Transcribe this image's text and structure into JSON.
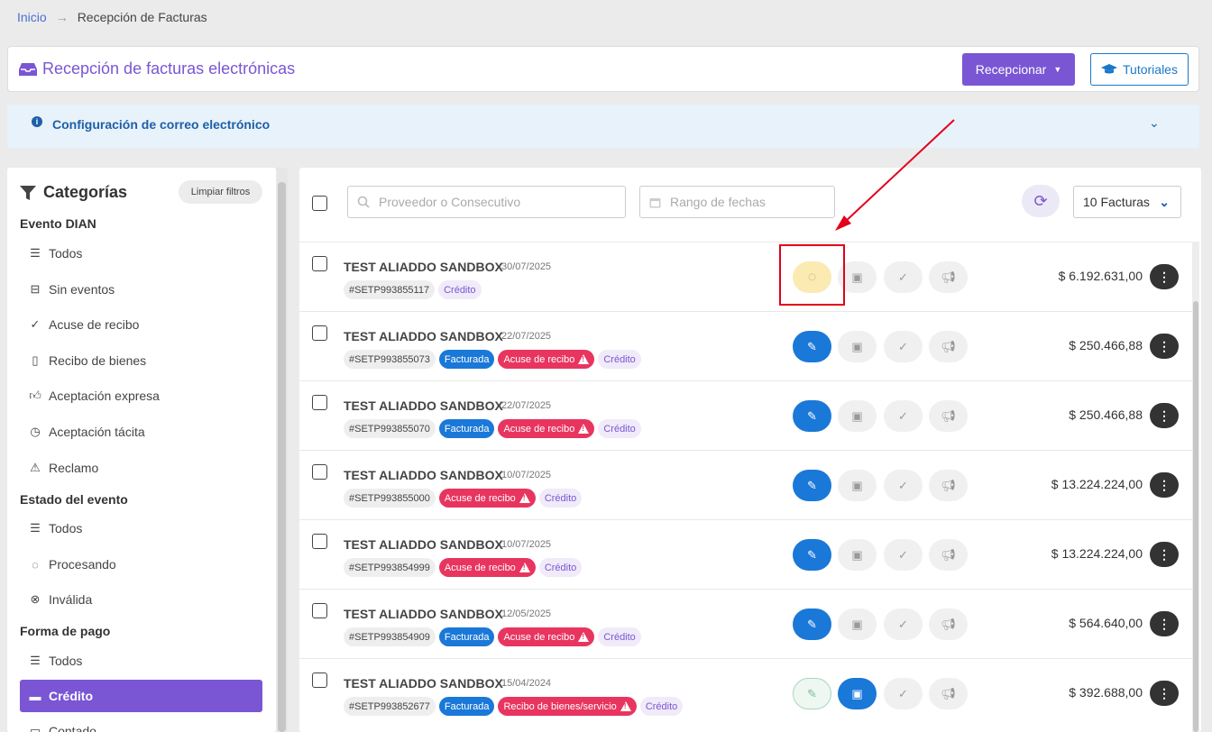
{
  "breadcrumb": {
    "home": "Inicio",
    "separator": "→",
    "current": "Recepción de Facturas"
  },
  "header": {
    "title": "Recepción de facturas electrónicas",
    "recepcionar_label": "Recepcionar",
    "tutoriales_label": "Tutoriales"
  },
  "email_config": {
    "label": "Configuración de correo electrónico"
  },
  "sidebar": {
    "title": "Categorías",
    "clear_label": "Limpiar filtros",
    "groups": [
      {
        "title": "Evento DIAN",
        "items": [
          "Todos",
          "Sin eventos",
          "Acuse de recibo",
          "Recibo de bienes",
          "Aceptación expresa",
          "Aceptación tácita",
          "Reclamo"
        ]
      },
      {
        "title": "Estado del evento",
        "items": [
          "Todos",
          "Procesando",
          "Inválida"
        ]
      },
      {
        "title": "Forma de pago",
        "items": [
          "Todos",
          "Crédito",
          "Contado"
        ]
      }
    ]
  },
  "toolbar": {
    "search_placeholder": "Proveedor o Consecutivo",
    "date_placeholder": "Rango de fechas",
    "count_label": "10 Facturas"
  },
  "invoices": [
    {
      "vendor": "TEST ALIADDO SANDBOX",
      "date": "30/07/2025",
      "number": "#SETP993855117",
      "tags": [
        {
          "text": "Crédito",
          "type": "cred"
        }
      ],
      "amount": "$ 6.192.631,00"
    },
    {
      "vendor": "TEST ALIADDO SANDBOX",
      "date": "22/07/2025",
      "number": "#SETP993855073",
      "tags": [
        {
          "text": "Facturada",
          "type": "fact"
        },
        {
          "text": "Acuse de recibo",
          "type": "acuse"
        },
        {
          "text": "Crédito",
          "type": "cred"
        }
      ],
      "amount": "$ 250.466,88"
    },
    {
      "vendor": "TEST ALIADDO SANDBOX",
      "date": "22/07/2025",
      "number": "#SETP993855070",
      "tags": [
        {
          "text": "Facturada",
          "type": "fact"
        },
        {
          "text": "Acuse de recibo",
          "type": "acuse"
        },
        {
          "text": "Crédito",
          "type": "cred"
        }
      ],
      "amount": "$ 250.466,88"
    },
    {
      "vendor": "TEST ALIADDO SANDBOX",
      "date": "10/07/2025",
      "number": "#SETP993855000",
      "tags": [
        {
          "text": "Acuse de recibo",
          "type": "acuse"
        },
        {
          "text": "Crédito",
          "type": "cred"
        }
      ],
      "amount": "$ 13.224.224,00"
    },
    {
      "vendor": "TEST ALIADDO SANDBOX",
      "date": "10/07/2025",
      "number": "#SETP993854999",
      "tags": [
        {
          "text": "Acuse de recibo",
          "type": "acuse"
        },
        {
          "text": "Crédito",
          "type": "cred"
        }
      ],
      "amount": "$ 13.224.224,00"
    },
    {
      "vendor": "TEST ALIADDO SANDBOX",
      "date": "12/05/2025",
      "number": "#SETP993854909",
      "tags": [
        {
          "text": "Facturada",
          "type": "fact"
        },
        {
          "text": "Acuse de recibo",
          "type": "acuse"
        },
        {
          "text": "Crédito",
          "type": "cred"
        }
      ],
      "amount": "$ 564.640,00"
    },
    {
      "vendor": "TEST ALIADDO SANDBOX",
      "date": "15/04/2024",
      "number": "#SETP993852677",
      "tags": [
        {
          "text": "Facturada",
          "type": "fact"
        },
        {
          "text": "Recibo de bienes/servicio",
          "type": "acuse"
        },
        {
          "text": "Crédito",
          "type": "cred"
        }
      ],
      "amount": "$ 392.688,00"
    }
  ],
  "colors": {
    "primary": "#7a56d4",
    "blue": "#1a78d8",
    "danger": "#e8355f",
    "highlight": "#e2001a"
  }
}
